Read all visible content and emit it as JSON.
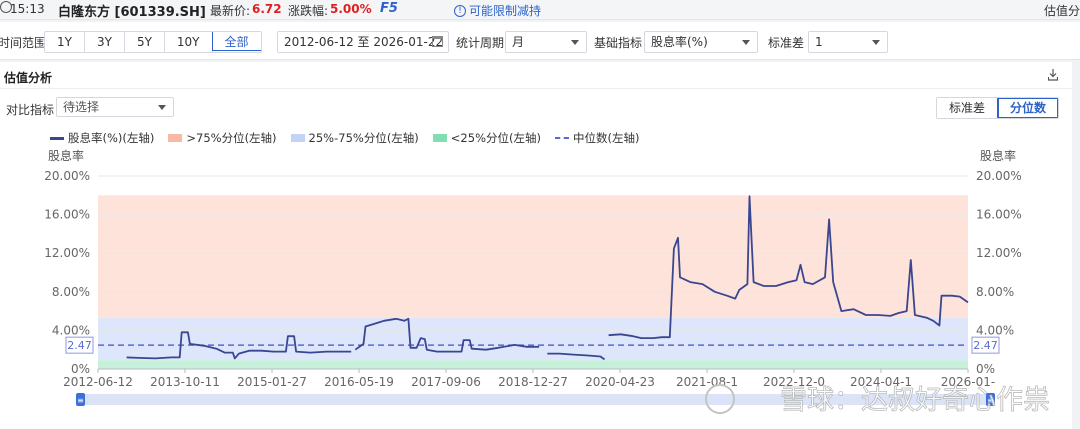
{
  "topbar": {
    "time": "15:13",
    "stock_name": "白隆东方 [601339.SH]",
    "latest_price_label": "最新价:",
    "latest_price": "6.72",
    "change_label": "涨跌幅:",
    "change": "5.00%",
    "f5": "F5",
    "restriction_notice": "可能限制减持",
    "right_tab": "估值分"
  },
  "filters": {
    "time_range_label": "时间范围",
    "ranges": [
      "1Y",
      "3Y",
      "5Y",
      "10Y",
      "全部"
    ],
    "active_range": "全部",
    "date_range": "2012-06-12 至 2026-01-22",
    "period_label": "统计周期",
    "period_value": "月",
    "indicator_label": "基础指标",
    "indicator_value": "股息率(%)",
    "std_label": "标准差",
    "std_value": "1"
  },
  "panel": {
    "title": "估值分析",
    "compare_label": "对比指标",
    "compare_placeholder": "待选择",
    "toggle": [
      "标准差",
      "分位数"
    ],
    "active_toggle": "分位数"
  },
  "colors": {
    "line": "#3a4690",
    "high_band": "#fde3da",
    "mid_band": "#dde6fb",
    "low_band": "#c6f0d9",
    "median": "#5a6ad0"
  },
  "chart_data": {
    "type": "line",
    "legend": [
      "股息率(%)(左轴)",
      ">75%分位(左轴)",
      "25%-75%分位(左轴)",
      "<25%分位(左轴)",
      "中位数(左轴)"
    ],
    "left_axis_title": "股息率",
    "right_axis_title": "股息率",
    "y_ticks": [
      "0%",
      "4.00%",
      "8.00%",
      "12.00%",
      "16.00%",
      "20.00%"
    ],
    "ylim": [
      0,
      20
    ],
    "x_ticks": [
      "2012-06-12",
      "2013-10-11",
      "2015-01-27",
      "2016-05-19",
      "2017-09-06",
      "2018-12-27",
      "2020-04-23",
      "2021-08-1",
      "2022-12-0",
      "2024-04-1",
      "2026-01-"
    ],
    "median_value": 2.47,
    "median_label": "2.47",
    "bands": {
      "p75": 5.3,
      "p25": 0.9,
      "max": 18.0
    },
    "series": [
      {
        "points": [
          [
            0.7,
            1.2
          ],
          [
            1.0,
            1.15
          ],
          [
            1.4,
            1.1
          ],
          [
            1.8,
            1.2
          ],
          [
            2.0,
            1.2
          ],
          [
            2.05,
            3.8
          ],
          [
            2.2,
            3.8
          ],
          [
            2.25,
            2.6
          ],
          [
            2.6,
            2.4
          ],
          [
            2.9,
            2.1
          ],
          [
            3.1,
            1.7
          ],
          [
            3.3,
            1.7
          ],
          [
            3.35,
            1.1
          ],
          [
            3.45,
            1.6
          ],
          [
            3.7,
            1.9
          ],
          [
            4.0,
            1.9
          ],
          [
            4.3,
            1.8
          ],
          [
            4.6,
            1.8
          ],
          [
            4.65,
            3.4
          ],
          [
            4.8,
            3.4
          ],
          [
            4.85,
            1.8
          ],
          [
            5.2,
            1.7
          ],
          [
            5.6,
            1.8
          ],
          [
            6.0,
            1.8
          ],
          [
            6.2,
            1.8
          ]
        ]
      },
      {
        "points": [
          [
            6.3,
            2.0
          ],
          [
            6.5,
            2.6
          ],
          [
            6.55,
            4.4
          ],
          [
            6.7,
            4.6
          ],
          [
            7.0,
            5.0
          ],
          [
            7.3,
            5.2
          ],
          [
            7.5,
            5.0
          ],
          [
            7.6,
            5.2
          ],
          [
            7.65,
            2.2
          ],
          [
            7.8,
            2.2
          ],
          [
            7.9,
            3.2
          ],
          [
            8.0,
            3.1
          ],
          [
            8.05,
            2.0
          ],
          [
            8.3,
            1.8
          ],
          [
            8.6,
            1.8
          ],
          [
            8.9,
            1.8
          ],
          [
            8.95,
            3.0
          ],
          [
            9.1,
            3.0
          ],
          [
            9.15,
            2.1
          ],
          [
            9.5,
            2.0
          ],
          [
            9.8,
            2.2
          ],
          [
            10.2,
            2.5
          ],
          [
            10.5,
            2.3
          ],
          [
            10.8,
            2.3
          ]
        ]
      },
      {
        "points": [
          [
            11.0,
            1.6
          ],
          [
            11.3,
            1.6
          ],
          [
            11.6,
            1.5
          ],
          [
            12.0,
            1.4
          ],
          [
            12.3,
            1.3
          ],
          [
            12.4,
            1.0
          ]
        ]
      },
      {
        "points": [
          [
            12.5,
            3.5
          ],
          [
            12.8,
            3.6
          ],
          [
            13.1,
            3.4
          ],
          [
            13.3,
            3.2
          ],
          [
            13.6,
            3.2
          ],
          [
            13.8,
            3.3
          ],
          [
            14.0,
            3.3
          ],
          [
            14.1,
            12.5
          ],
          [
            14.2,
            13.6
          ],
          [
            14.25,
            9.5
          ],
          [
            14.5,
            9.0
          ],
          [
            14.8,
            8.8
          ],
          [
            15.1,
            8.0
          ],
          [
            15.4,
            7.6
          ],
          [
            15.6,
            7.3
          ],
          [
            15.7,
            8.2
          ],
          [
            15.9,
            8.8
          ],
          [
            15.95,
            17.9
          ],
          [
            16.05,
            9.0
          ],
          [
            16.3,
            8.6
          ],
          [
            16.6,
            8.6
          ],
          [
            16.9,
            9.0
          ],
          [
            17.1,
            9.2
          ],
          [
            17.2,
            10.8
          ],
          [
            17.3,
            9.0
          ],
          [
            17.5,
            8.8
          ],
          [
            17.8,
            9.5
          ],
          [
            17.9,
            15.5
          ],
          [
            18.0,
            9.0
          ],
          [
            18.2,
            6.0
          ],
          [
            18.5,
            6.2
          ],
          [
            18.8,
            5.6
          ],
          [
            19.1,
            5.6
          ],
          [
            19.4,
            5.5
          ],
          [
            19.6,
            5.8
          ],
          [
            19.8,
            6.0
          ],
          [
            19.9,
            11.3
          ],
          [
            20.0,
            5.6
          ],
          [
            20.3,
            5.3
          ],
          [
            20.45,
            5.0
          ],
          [
            20.6,
            4.5
          ],
          [
            20.65,
            7.6
          ],
          [
            20.9,
            7.6
          ],
          [
            21.1,
            7.5
          ],
          [
            21.3,
            6.9
          ]
        ]
      }
    ],
    "x_range": [
      0,
      21.3
    ]
  },
  "slider": {
    "handle_left": "≡",
    "handle_right": "≡"
  },
  "watermark": "雪球：达叔好奇心作祟"
}
